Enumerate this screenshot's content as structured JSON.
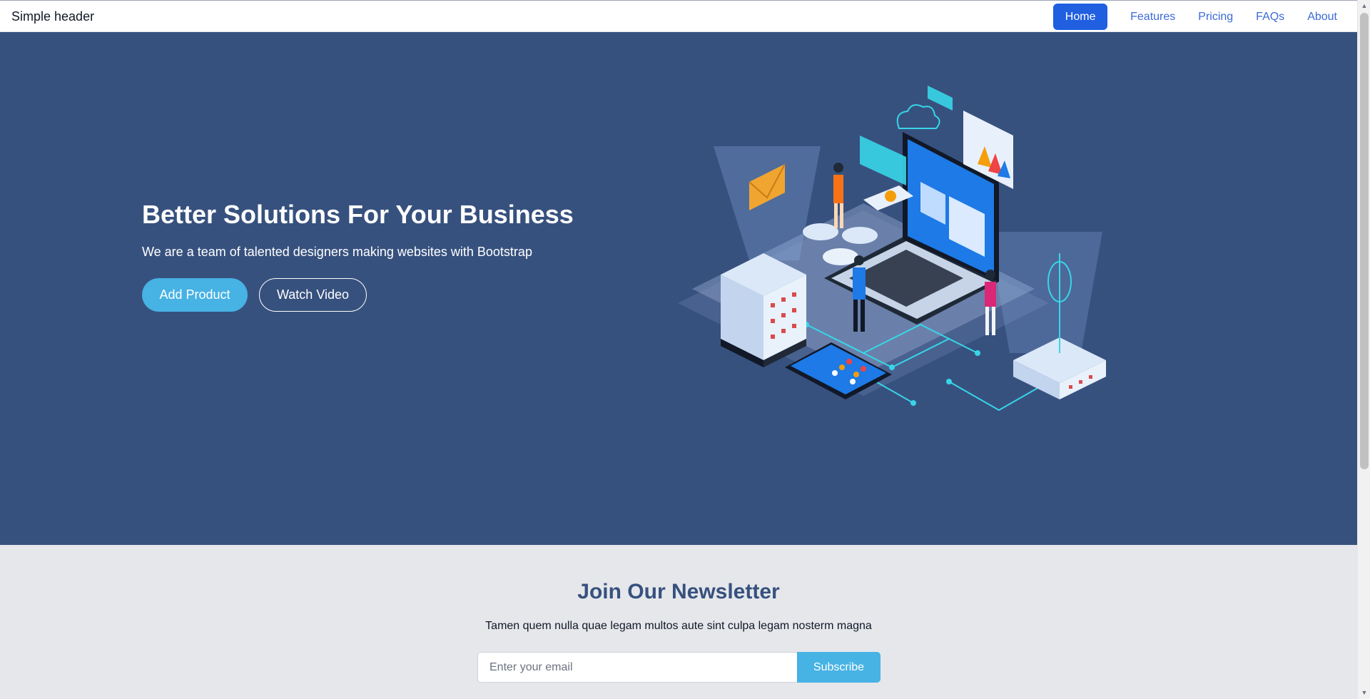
{
  "header": {
    "brand": "Simple header",
    "nav": [
      {
        "label": "Home",
        "active": true
      },
      {
        "label": "Features",
        "active": false
      },
      {
        "label": "Pricing",
        "active": false
      },
      {
        "label": "FAQs",
        "active": false
      },
      {
        "label": "About",
        "active": false
      }
    ]
  },
  "hero": {
    "title": "Better Solutions For Your Business",
    "subtitle": "We are a team of talented designers making websites with Bootstrap",
    "primary_button": "Add Product",
    "secondary_button": "Watch Video",
    "illustration": "isometric-tech-illustration"
  },
  "newsletter": {
    "title": "Join Our Newsletter",
    "subtitle": "Tamen quem nulla quae legam multos aute sint culpa legam nosterm magna",
    "email_placeholder": "Enter your email",
    "email_value": "",
    "subscribe_button": "Subscribe"
  },
  "colors": {
    "hero_bg": "#37517e",
    "accent": "#47b2e4",
    "nav_active": "#1f5fe0",
    "newsletter_bg": "#e5e7eb"
  }
}
